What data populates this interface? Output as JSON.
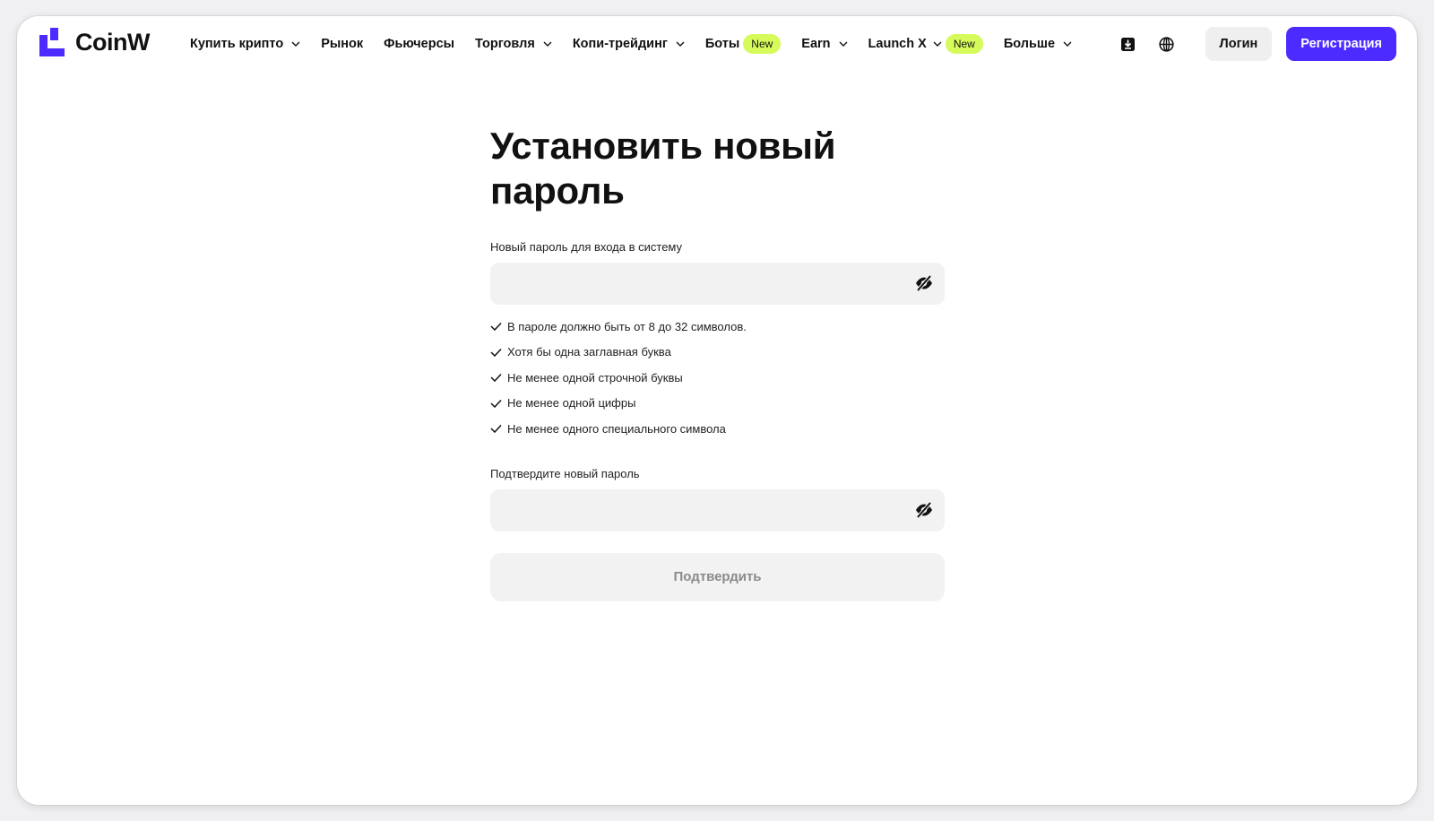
{
  "brand": {
    "name": "CoinW",
    "accent": "#4b2bff",
    "badge_color": "#d6fa5a"
  },
  "nav": {
    "items": [
      {
        "label": "Купить крипто",
        "dropdown": true,
        "badge": ""
      },
      {
        "label": "Рынок",
        "dropdown": false,
        "badge": ""
      },
      {
        "label": "Фьючерсы",
        "dropdown": false,
        "badge": ""
      },
      {
        "label": "Торговля",
        "dropdown": true,
        "badge": ""
      },
      {
        "label": "Копи-трейдинг",
        "dropdown": true,
        "badge": ""
      },
      {
        "label": "Боты",
        "dropdown": false,
        "badge": "New"
      },
      {
        "label": "Earn",
        "dropdown": true,
        "badge": ""
      },
      {
        "label": "Launch X",
        "dropdown": true,
        "badge": "New"
      },
      {
        "label": "Больше",
        "dropdown": true,
        "badge": ""
      }
    ]
  },
  "header": {
    "icons": [
      "download-icon",
      "globe-icon"
    ],
    "login_label": "Логин",
    "register_label": "Регистрация"
  },
  "form": {
    "title": "Установить новый пароль",
    "new_password": {
      "label": "Новый пароль для входа в систему",
      "value": "",
      "placeholder": ""
    },
    "rules": [
      "В пароле должно быть от 8 до 32 символов.",
      "Хотя бы одна заглавная буква",
      "Не менее одной строчной буквы",
      "Не менее одной цифры",
      "Не менее одного специального символа"
    ],
    "confirm_password": {
      "label": "Подтвердите новый пароль",
      "value": "",
      "placeholder": ""
    },
    "submit_label": "Подтвердить"
  }
}
